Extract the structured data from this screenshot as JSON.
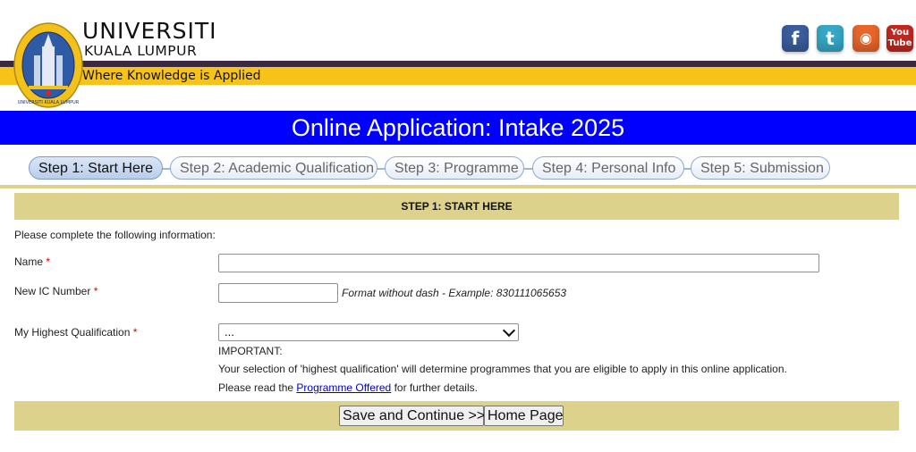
{
  "header": {
    "university_name": "UNIVERSITI",
    "university_sub": "KUALA LUMPUR",
    "tagline": "Where Knowledge is Applied",
    "logo_ring_text": "UNIVERSITI KUALA LUMPUR",
    "social": [
      {
        "name": "facebook",
        "glyph": "f"
      },
      {
        "name": "twitter",
        "glyph": "t"
      },
      {
        "name": "rss",
        "glyph": "◉"
      },
      {
        "name": "youtube",
        "glyph": "You Tube"
      }
    ]
  },
  "title": "Online Application: Intake 2025",
  "steps": [
    {
      "label": "Step 1: Start Here",
      "active": true
    },
    {
      "label": "Step 2: Academic Qualification",
      "active": false
    },
    {
      "label": "Step 3: Programme",
      "active": false
    },
    {
      "label": "Step 4: Personal Info",
      "active": false
    },
    {
      "label": "Step 5: Submission",
      "active": false
    }
  ],
  "form": {
    "section_heading": "STEP 1: START HERE",
    "intro": "Please complete the following information:",
    "name_label": "Name",
    "required_mark": "*",
    "name_value": "",
    "ic_label": "New IC Number",
    "ic_value": "",
    "ic_hint": "Format without dash - Example: 830111065653",
    "qualification_label": "My Highest Qualification",
    "qualification_selected": "...",
    "important_title": "IMPORTANT:",
    "important_text": "Your selection of 'highest qualification' will determine programmes that you are eligible to apply in this online application.",
    "read_prefix": "Please read the",
    "read_link": "Programme Offered",
    "read_suffix": "for further details.",
    "save_button": "Save and Continue >>",
    "home_button": "Home Page"
  },
  "colors": {
    "title_bar": "#0000ff",
    "header_yellow": "#f7c318",
    "section_gold": "#dcd28b"
  }
}
